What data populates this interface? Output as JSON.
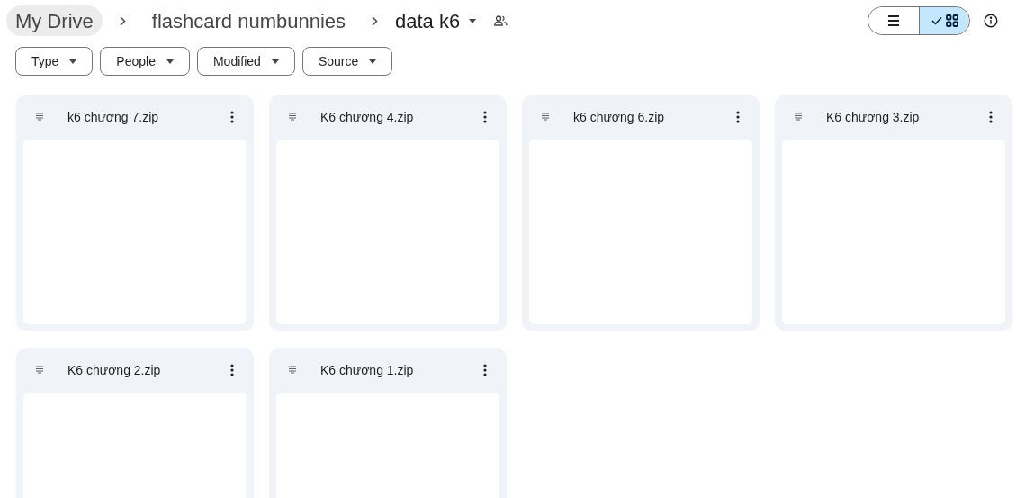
{
  "breadcrumbs": [
    {
      "label": "My Drive",
      "current": false
    },
    {
      "label": "flashcard numbunnies",
      "current": false
    },
    {
      "label": "data k6",
      "current": true
    }
  ],
  "view_toggle": [
    {
      "kind": "list",
      "selected": false
    },
    {
      "kind": "grid",
      "selected": true
    }
  ],
  "filters": [
    "Type",
    "People",
    "Modified",
    "Source"
  ],
  "files": [
    {
      "name": "k6 chương 7.zip"
    },
    {
      "name": "K6 chương 4.zip"
    },
    {
      "name": "k6 chương 6.zip"
    },
    {
      "name": "K6 chương 3.zip"
    },
    {
      "name": "K6 chương 2.zip"
    },
    {
      "name": "K6 chương 1.zip"
    }
  ]
}
